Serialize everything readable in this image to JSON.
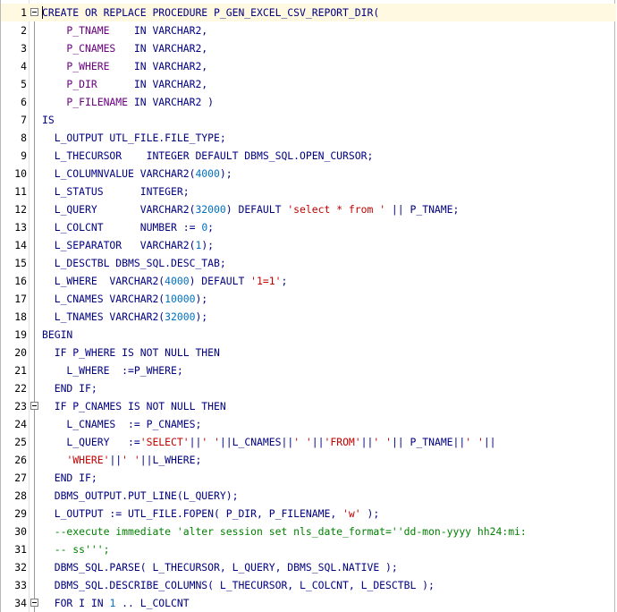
{
  "editor": {
    "lines": [
      {
        "n": "1",
        "fold": true,
        "tokens": [
          [
            "kw",
            "CREATE OR REPLACE PROCEDURE P_GEN_EXCEL_CSV_REPORT_DIR("
          ]
        ]
      },
      {
        "n": "2",
        "tokens": [
          [
            "id",
            "    P_TNAME    "
          ],
          [
            "kw",
            "IN VARCHAR2,"
          ]
        ]
      },
      {
        "n": "3",
        "tokens": [
          [
            "id",
            "    P_CNAMES   "
          ],
          [
            "kw",
            "IN VARCHAR2,"
          ]
        ]
      },
      {
        "n": "4",
        "tokens": [
          [
            "id",
            "    P_WHERE    "
          ],
          [
            "kw",
            "IN VARCHAR2,"
          ]
        ]
      },
      {
        "n": "5",
        "tokens": [
          [
            "id",
            "    P_DIR      "
          ],
          [
            "kw",
            "IN VARCHAR2,"
          ]
        ]
      },
      {
        "n": "6",
        "tokens": [
          [
            "id",
            "    P_FILENAME "
          ],
          [
            "kw",
            "IN VARCHAR2 "
          ],
          [
            "t",
            "plain",
            ")"
          ]
        ]
      },
      {
        "n": "7",
        "tokens": [
          [
            "kw",
            "IS"
          ]
        ]
      },
      {
        "n": "8",
        "tokens": [
          [
            "kw",
            "  L_OUTPUT UTL_FILE.FILE_TYPE;"
          ]
        ]
      },
      {
        "n": "9",
        "tokens": [
          [
            "kw",
            "  L_THECURSOR    INTEGER DEFAULT DBMS_SQL.OPEN_CURSOR;"
          ]
        ]
      },
      {
        "n": "10",
        "tokens": [
          [
            "kw",
            "  L_COLUMNVALUE VARCHAR2("
          ],
          [
            "num",
            "4000"
          ],
          [
            "kw",
            ");"
          ]
        ]
      },
      {
        "n": "11",
        "tokens": [
          [
            "kw",
            "  L_STATUS      INTEGER;"
          ]
        ]
      },
      {
        "n": "12",
        "tokens": [
          [
            "kw",
            "  L_QUERY       VARCHAR2("
          ],
          [
            "num",
            "32000"
          ],
          [
            "kw",
            ") DEFAULT "
          ],
          [
            "str",
            "'select * from '"
          ],
          [
            "kw",
            " || P_TNAME;"
          ]
        ]
      },
      {
        "n": "13",
        "tokens": [
          [
            "kw",
            "  L_COLCNT      NUMBER := "
          ],
          [
            "num",
            "0"
          ],
          [
            "kw",
            ";"
          ]
        ]
      },
      {
        "n": "14",
        "tokens": [
          [
            "kw",
            "  L_SEPARATOR   VARCHAR2("
          ],
          [
            "num",
            "1"
          ],
          [
            "kw",
            ");"
          ]
        ]
      },
      {
        "n": "15",
        "tokens": [
          [
            "kw",
            "  L_DESCTBL DBMS_SQL.DESC_TAB;"
          ]
        ]
      },
      {
        "n": "16",
        "tokens": [
          [
            "kw",
            "  L_WHERE  VARCHAR2("
          ],
          [
            "num",
            "4000"
          ],
          [
            "kw",
            ") DEFAULT "
          ],
          [
            "str",
            "'1=1'"
          ],
          [
            "kw",
            ";"
          ]
        ]
      },
      {
        "n": "17",
        "tokens": [
          [
            "kw",
            "  L_CNAMES VARCHAR2("
          ],
          [
            "num",
            "10000"
          ],
          [
            "kw",
            ");"
          ]
        ]
      },
      {
        "n": "18",
        "tokens": [
          [
            "kw",
            "  L_TNAMES VARCHAR2("
          ],
          [
            "num",
            "32000"
          ],
          [
            "kw",
            ");"
          ]
        ]
      },
      {
        "n": "19",
        "tokens": [
          [
            "kw",
            "BEGIN"
          ]
        ]
      },
      {
        "n": "20",
        "tokens": [
          [
            "kw",
            "  IF P_WHERE IS NOT NULL THEN"
          ]
        ]
      },
      {
        "n": "21",
        "tokens": [
          [
            "kw",
            "    L_WHERE  :=P_WHERE;"
          ]
        ]
      },
      {
        "n": "22",
        "tokens": [
          [
            "kw",
            "  END IF;"
          ]
        ]
      },
      {
        "n": "23",
        "fold": true,
        "tokens": [
          [
            "kw",
            "  IF P_CNAMES IS NOT NULL THEN"
          ]
        ]
      },
      {
        "n": "24",
        "tokens": [
          [
            "kw",
            "    L_CNAMES  := P_CNAMES;"
          ]
        ]
      },
      {
        "n": "25",
        "tokens": [
          [
            "kw",
            "    L_QUERY   :="
          ],
          [
            "str",
            "'SELECT'"
          ],
          [
            "kw",
            "||"
          ],
          [
            "str",
            "' '"
          ],
          [
            "kw",
            "||L_CNAMES||"
          ],
          [
            "str",
            "' '"
          ],
          [
            "kw",
            "||"
          ],
          [
            "str",
            "'FROM'"
          ],
          [
            "kw",
            "||"
          ],
          [
            "str",
            "' '"
          ],
          [
            "kw",
            "|| P_TNAME||"
          ],
          [
            "str",
            "' '"
          ],
          [
            "kw",
            "||"
          ]
        ]
      },
      {
        "n": "26",
        "tokens": [
          [
            "kw",
            "    "
          ],
          [
            "str",
            "'WHERE'"
          ],
          [
            "kw",
            "||"
          ],
          [
            "str",
            "' '"
          ],
          [
            "kw",
            "||L_WHERE;"
          ]
        ]
      },
      {
        "n": "27",
        "tokens": [
          [
            "kw",
            "  END IF;"
          ]
        ]
      },
      {
        "n": "28",
        "tokens": [
          [
            "kw",
            "  DBMS_OUTPUT.PUT_LINE(L_QUERY);"
          ]
        ]
      },
      {
        "n": "29",
        "tokens": [
          [
            "kw",
            "  L_OUTPUT := UTL_FILE.FOPEN( P_DIR, P_FILENAME, "
          ],
          [
            "str",
            "'w'"
          ],
          [
            "kw",
            " );"
          ]
        ]
      },
      {
        "n": "30",
        "tokens": [
          [
            "cmt",
            "  --execute immediate 'alter session set nls_date_format=''dd-mon-yyyy hh24:mi:"
          ]
        ]
      },
      {
        "n": "31",
        "tokens": [
          [
            "cmt",
            "  -- ss''';"
          ]
        ]
      },
      {
        "n": "32",
        "tokens": [
          [
            "kw",
            "  DBMS_SQL.PARSE( L_THECURSOR, L_QUERY, DBMS_SQL.NATIVE );"
          ]
        ]
      },
      {
        "n": "33",
        "tokens": [
          [
            "kw",
            "  DBMS_SQL.DESCRIBE_COLUMNS( L_THECURSOR, L_COLCNT, L_DESCTBL );"
          ]
        ]
      },
      {
        "n": "34",
        "fold": true,
        "tokens": [
          [
            "kw",
            "  FOR I IN "
          ],
          [
            "num",
            "1"
          ],
          [
            "kw",
            " .. L_COLCNT"
          ]
        ]
      }
    ]
  }
}
